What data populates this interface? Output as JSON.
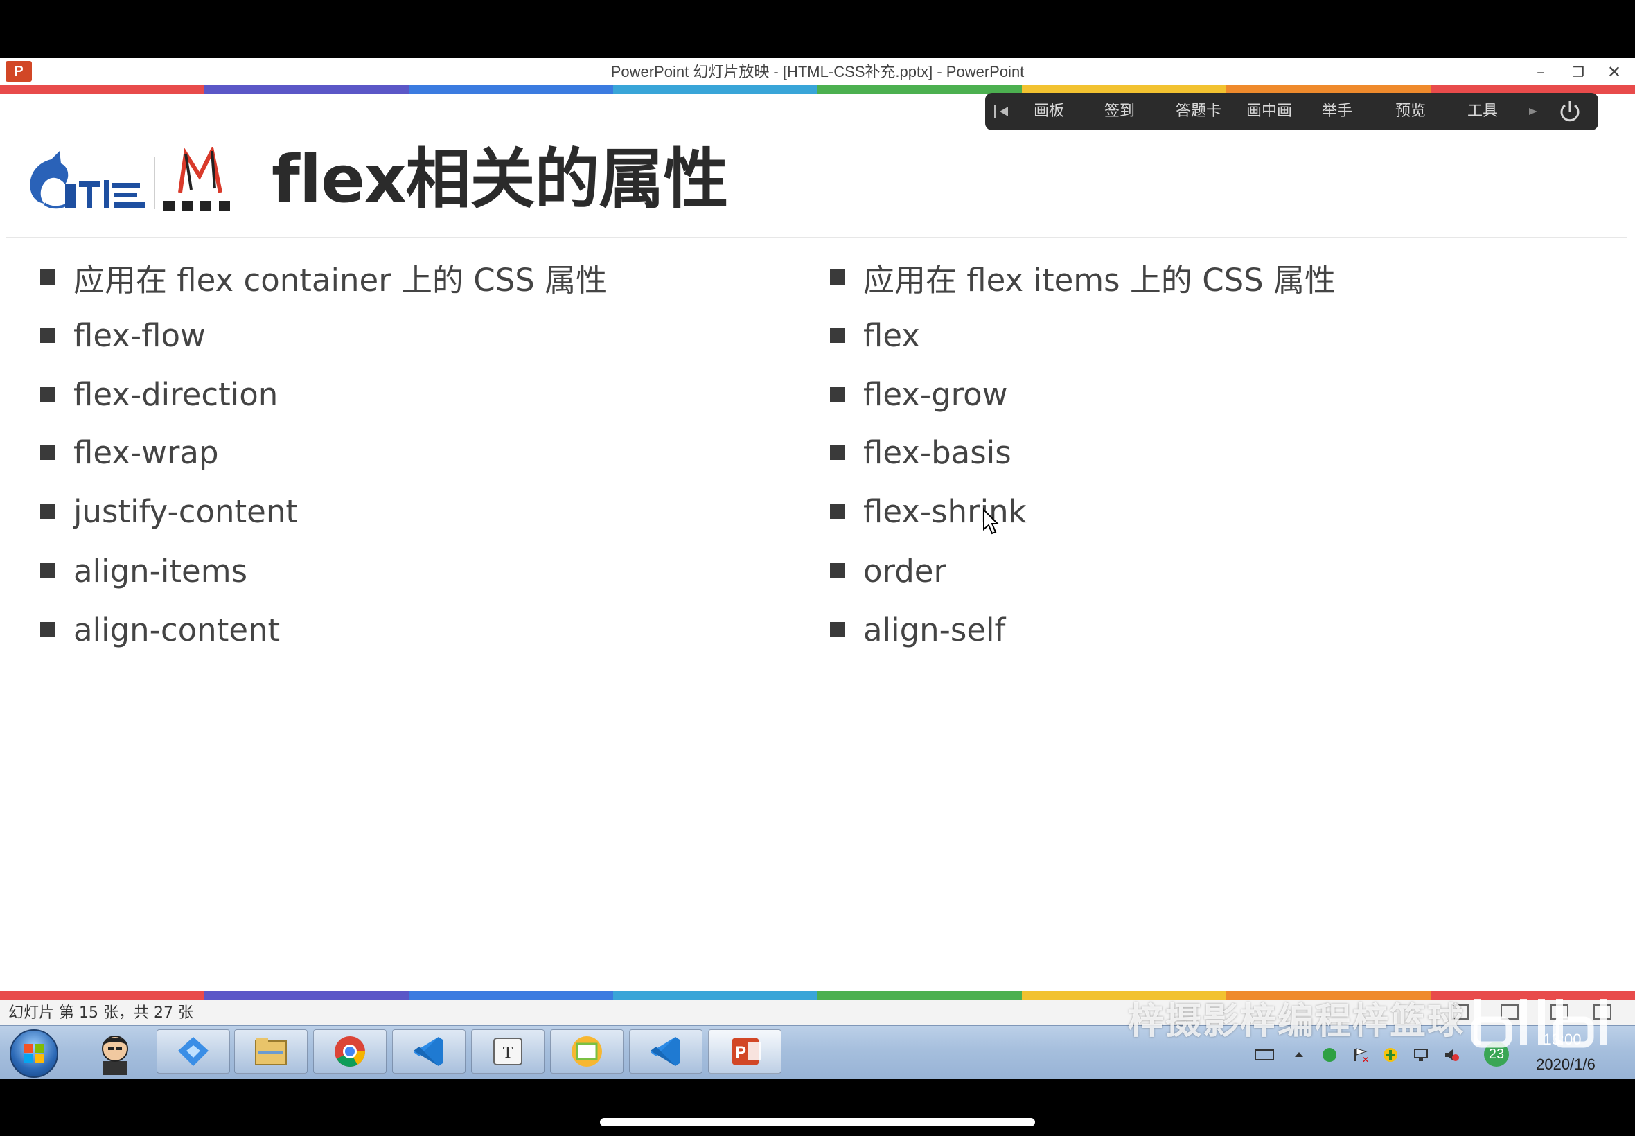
{
  "window": {
    "title": "PowerPoint 幻灯片放映 - [HTML-CSS补充.pptx] - PowerPoint",
    "app_icon": "P",
    "minimize": "–",
    "restore": "❐",
    "close": "✕"
  },
  "slideshow_toolbar": {
    "items": [
      "画板",
      "签到",
      "答题卡",
      "画中画",
      "举手",
      "预览",
      "工具"
    ]
  },
  "slide": {
    "title": "flex相关的属性",
    "left_column": [
      "应用在 flex container 上的 CSS 属性",
      "flex-flow",
      "flex-direction",
      "flex-wrap",
      "justify-content",
      "align-items",
      "align-content"
    ],
    "right_column": [
      "应用在 flex items 上的 CSS 属性",
      "flex",
      "flex-grow",
      "flex-basis",
      "flex-shrink",
      "order",
      "align-self"
    ]
  },
  "status_bar": {
    "slide_info": "幻灯片 第 15 张，共 27 张"
  },
  "watermark": "梓摄影梓编程梓篮球",
  "taskbar": {
    "clock_time": "13:00",
    "clock_date": "2020/1/6",
    "notification_count": "23",
    "apps": [
      "user-avatar",
      "feishu",
      "file-explorer",
      "chrome",
      "vscode",
      "typora",
      "sketch",
      "vscode",
      "powerpoint"
    ]
  },
  "colors": {
    "stripe": [
      "#e84b4b",
      "#5b57c7",
      "#3b7be0",
      "#39a5d8",
      "#4cb050",
      "#f2c230",
      "#ef8a2c",
      "#e84b4b"
    ],
    "slide_title": "#2b2b2b",
    "bullet_text": "#444444"
  }
}
